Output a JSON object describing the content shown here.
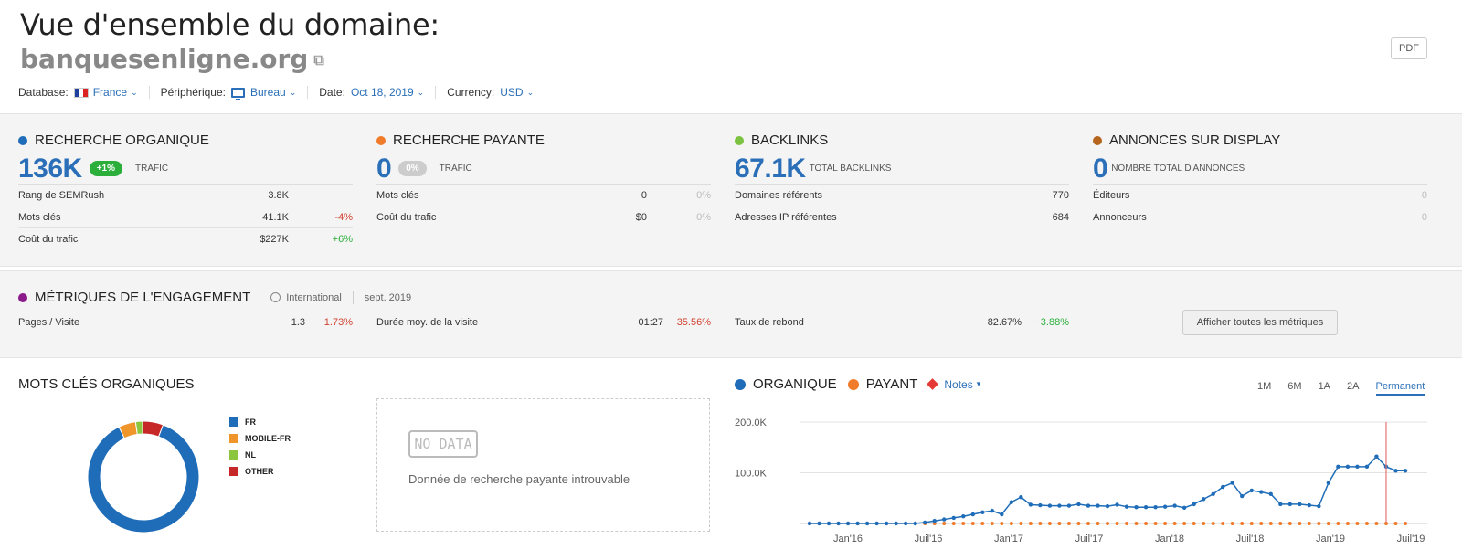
{
  "header": {
    "title": "Vue d'ensemble du domaine:",
    "domain": "banquesenligne.org",
    "pdf_label": "PDF",
    "filters": {
      "database_label": "Database:",
      "database_value": "France",
      "device_label": "Périphérique:",
      "device_value": "Bureau",
      "date_label": "Date:",
      "date_value": "Oct 18, 2019",
      "currency_label": "Currency:",
      "currency_value": "USD"
    }
  },
  "cards": {
    "organic": {
      "title": "RECHERCHE ORGANIQUE",
      "color": "#1f6db8",
      "big": "136K",
      "pill": "+1%",
      "big_label": "TRAFIC",
      "rows": [
        {
          "k": "Rang de SEMRush",
          "v": "3.8K",
          "d": ""
        },
        {
          "k": "Mots clés",
          "v": "41.1K",
          "d": "-4%"
        },
        {
          "k": "Coût du trafic",
          "v": "$227K",
          "d": "+6%"
        }
      ]
    },
    "paid": {
      "title": "RECHERCHE PAYANTE",
      "color": "#f07b2a",
      "big": "0",
      "pill": "0%",
      "big_label": "TRAFIC",
      "rows": [
        {
          "k": "Mots clés",
          "v": "0",
          "d": "0%"
        },
        {
          "k": "Coût du trafic",
          "v": "$0",
          "d": "0%"
        }
      ]
    },
    "backlinks": {
      "title": "BACKLINKS",
      "color": "#7cc242",
      "big": "67.1K",
      "big_label": "TOTAL BACKLINKS",
      "rows": [
        {
          "k": "Domaines référents",
          "v": "770",
          "d": ""
        },
        {
          "k": "Adresses IP référentes",
          "v": "684",
          "d": ""
        }
      ]
    },
    "display": {
      "title": "ANNONCES SUR DISPLAY",
      "color": "#b5651d",
      "big": "0",
      "big_label": "NOMBRE TOTAL D'ANNONCES",
      "rows": [
        {
          "k": "Éditeurs",
          "v": "0",
          "d": ""
        },
        {
          "k": "Annonceurs",
          "v": "0",
          "d": ""
        }
      ]
    }
  },
  "engagement": {
    "title": "MÉTRIQUES DE L'ENGAGEMENT",
    "color": "#8b1a8b",
    "scope": "International",
    "period": "sept. 2019",
    "metrics": [
      {
        "k": "Pages / Visite",
        "v": "1.3",
        "d": "−1.73%"
      },
      {
        "k": "Durée moy. de la visite",
        "v": "01:27",
        "d": "−35.56%"
      },
      {
        "k": "Taux de rebond",
        "v": "82.67%",
        "d": "−3.88%"
      }
    ],
    "button": "Afficher toutes les métriques"
  },
  "organic_keywords": {
    "title": "MOTS CLÉS ORGANIQUES",
    "legend": [
      {
        "label": "FR",
        "color": "#1f6db8",
        "value": 0.87
      },
      {
        "label": "MOBILE-FR",
        "color": "#f0952a",
        "value": 0.05
      },
      {
        "label": "NL",
        "color": "#8cc63f",
        "value": 0.02
      },
      {
        "label": "OTHER",
        "color": "#c62828",
        "value": 0.06
      }
    ]
  },
  "paid_search": {
    "badge": "NO DATA",
    "message": "Donnée de recherche payante introuvable"
  },
  "trend": {
    "legend": {
      "organic": "ORGANIQUE",
      "paid": "PAYANT",
      "notes": "Notes"
    },
    "periods": [
      "1M",
      "6M",
      "1A",
      "2A",
      "Permanent"
    ],
    "active_period": "Permanent"
  },
  "chart_data": {
    "type": "line",
    "y_ticks": [
      "200.0K",
      "100.0K"
    ],
    "ylim": [
      0,
      200000
    ],
    "x_ticks": [
      "Jan'16",
      "Juil'16",
      "Jan'17",
      "Juil'17",
      "Jan'18",
      "Juil'18",
      "Jan'19",
      "Juil'19"
    ],
    "series": [
      {
        "name": "ORGANIQUE",
        "color": "#1f6db8",
        "values": [
          0,
          0,
          0,
          0,
          0,
          0,
          0,
          0,
          0,
          0,
          0,
          0,
          2000,
          5000,
          8000,
          11000,
          14000,
          18000,
          22000,
          25000,
          18000,
          42000,
          52000,
          37000,
          36000,
          35000,
          35000,
          35000,
          38000,
          35000,
          35000,
          34000,
          37000,
          33000,
          32000,
          32000,
          32000,
          33000,
          35000,
          31000,
          38000,
          48000,
          58000,
          72000,
          80000,
          54000,
          65000,
          62000,
          58000,
          38000,
          38000,
          38000,
          36000,
          34000,
          80000,
          112000,
          112000,
          112000,
          112000,
          132000,
          112000,
          104000,
          104000
        ]
      },
      {
        "name": "PAYANT",
        "color": "#f07b2a",
        "values": [
          0,
          0,
          0,
          0,
          0,
          0,
          0,
          0,
          0,
          0,
          0,
          0,
          0,
          0,
          0,
          0,
          0,
          0,
          0,
          0,
          0,
          0,
          0,
          0,
          0,
          0,
          0,
          0,
          0,
          0,
          0,
          0,
          0,
          0,
          0,
          0,
          0,
          0,
          0,
          0,
          0,
          0,
          0,
          0,
          0,
          0,
          0,
          0,
          0,
          0,
          0,
          0,
          0,
          0,
          0,
          0,
          0,
          0,
          0,
          0,
          0,
          0,
          0
        ]
      }
    ],
    "grid": true
  }
}
